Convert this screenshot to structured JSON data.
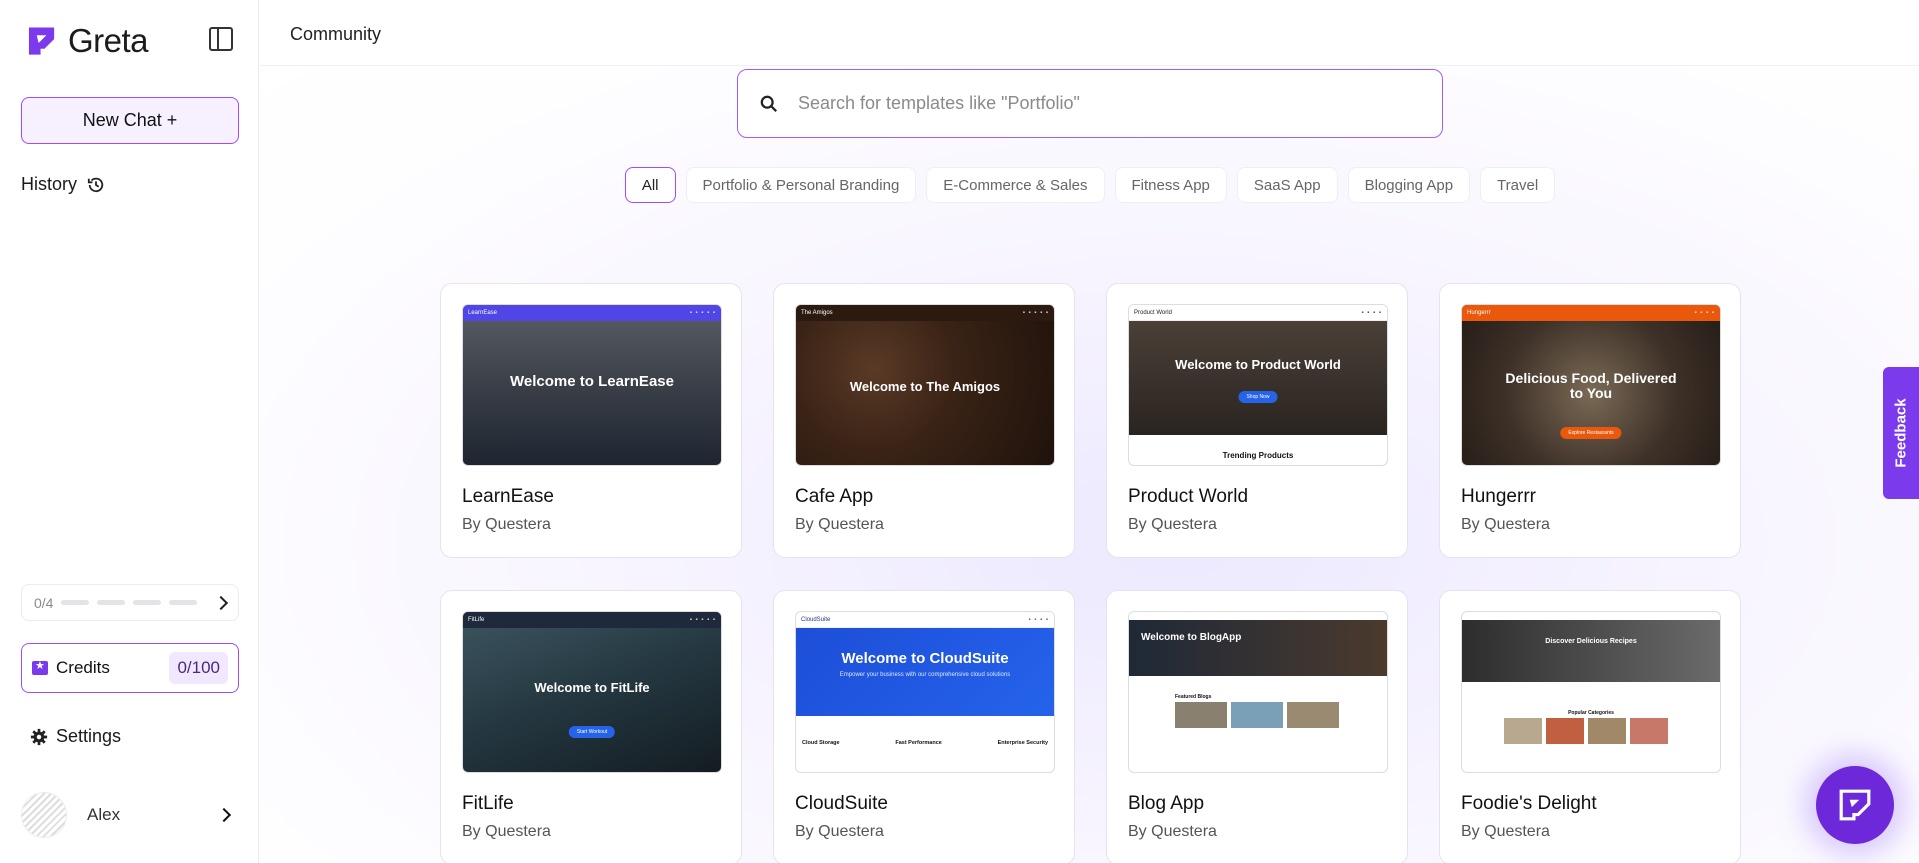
{
  "app": {
    "name": "Greta",
    "brand_color": "#7c3aed"
  },
  "sidebar": {
    "new_chat_label": "New Chat +",
    "history_label": "History",
    "progress_text": "0/4",
    "credits_label": "Credits",
    "credits_count": "0/100",
    "settings_label": "Settings",
    "user_name": "Alex"
  },
  "header": {
    "title": "Community"
  },
  "search": {
    "placeholder": "Search for templates like \"Portfolio\""
  },
  "filters": [
    "All",
    "Portfolio & Personal Branding",
    "E-Commerce & Sales",
    "Fitness App",
    "SaaS App",
    "Blogging App",
    "Travel"
  ],
  "active_filter": "All",
  "templates": [
    {
      "title": "LearnEase",
      "author": "By Questera",
      "thumb_brand": "LearnEase",
      "thumb_headline": "Welcome to LearnEase"
    },
    {
      "title": "Cafe App",
      "author": "By Questera",
      "thumb_brand": "The Amigos",
      "thumb_headline": "Welcome to The Amigos"
    },
    {
      "title": "Product World",
      "author": "By Questera",
      "thumb_brand": "Product World",
      "thumb_headline": "Welcome to Product World",
      "thumb_button": "Shop Now",
      "thumb_footer": "Trending Products"
    },
    {
      "title": "Hungerrr",
      "author": "By Questera",
      "thumb_brand": "Hungerrr",
      "thumb_headline": "Delicious Food, Delivered to You",
      "thumb_button": "Explore Restaurants"
    },
    {
      "title": "FitLife",
      "author": "By Questera",
      "thumb_brand": "FitLife",
      "thumb_headline": "Welcome to FitLife",
      "thumb_button": "Start Workout"
    },
    {
      "title": "CloudSuite",
      "author": "By Questera",
      "thumb_brand": "CloudSuite",
      "thumb_headline": "Welcome to CloudSuite",
      "thumb_sub": "Empower your business with our comprehensive cloud solutions",
      "thumb_features": [
        "Cloud Storage",
        "Fast Performance",
        "Enterprise Security"
      ]
    },
    {
      "title": "Blog App",
      "author": "By Questera",
      "thumb_headline": "Welcome to BlogApp",
      "thumb_section": "Featured Blogs"
    },
    {
      "title": "Foodie's Delight",
      "author": "By Questera",
      "thumb_headline": "Discover Delicious Recipes",
      "thumb_section": "Popular Categories"
    }
  ],
  "feedback_label": "Feedback"
}
